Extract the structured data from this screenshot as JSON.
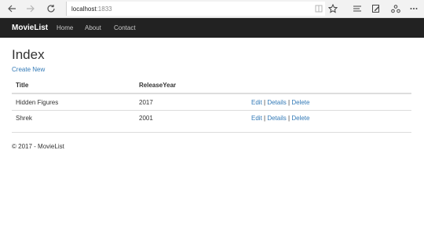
{
  "browser": {
    "url_host": "localhost",
    "url_port": ":1833"
  },
  "navbar": {
    "brand": "MovieList",
    "links": [
      "Home",
      "About",
      "Contact"
    ]
  },
  "page": {
    "title": "Index",
    "create_link": "Create New"
  },
  "table": {
    "headers": [
      "Title",
      "ReleaseYear"
    ],
    "rows": [
      {
        "title": "Hidden Figures",
        "year": "2017",
        "actions": [
          "Edit",
          "Details",
          "Delete"
        ]
      },
      {
        "title": "Shrek",
        "year": "2001",
        "actions": [
          "Edit",
          "Details",
          "Delete"
        ]
      }
    ],
    "separator": " | "
  },
  "footer": {
    "text": "© 2017 - MovieList"
  },
  "colors": {
    "navbar_bg": "#222222",
    "link": "#337ab7",
    "text": "#333333"
  },
  "icons": [
    "back-arrow-icon",
    "forward-arrow-icon",
    "refresh-icon",
    "reading-view-icon",
    "favorite-star-icon",
    "hub-icon",
    "web-note-icon",
    "share-icon",
    "more-icon"
  ]
}
